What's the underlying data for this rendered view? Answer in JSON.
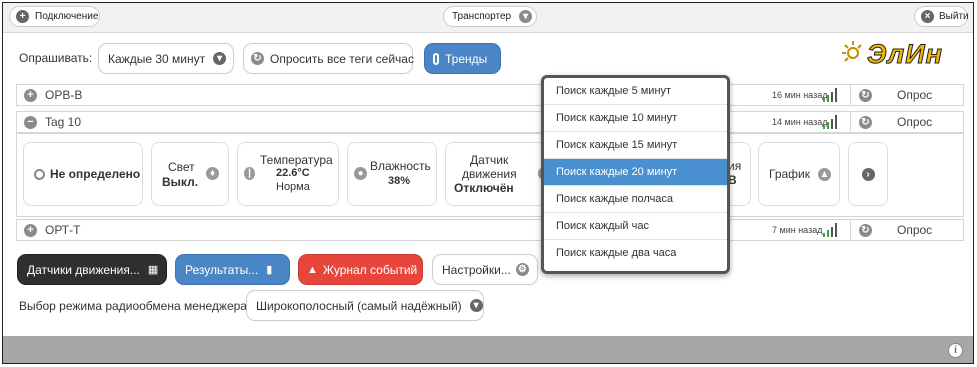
{
  "topbar": {
    "connect": "Подключение",
    "transport": "Транспортер",
    "exit": "Выйти"
  },
  "toolbar": {
    "poll_label": "Опрашивать:",
    "interval_value": "Каждые 30 минут",
    "poll_all": "Опросить все теги сейчас",
    "trends": "Тренды"
  },
  "logo": {
    "text": "ЭлИн",
    "color": "#f2b705"
  },
  "tags": [
    {
      "name": "ОРВ-В",
      "time": "16 мин назад",
      "action": "Опрос"
    },
    {
      "name": "Tag 10",
      "time": "14 мин назад",
      "action": "Опрос"
    },
    {
      "name": "ОРТ-Т",
      "time": "7 мин назад",
      "action": "Опрос"
    }
  ],
  "cards": {
    "state": "Не определено",
    "light_label": "Свет",
    "light_value": "Выкл.",
    "temp_label": "Температура",
    "temp_value": "22.6°C",
    "temp_status": "Норма",
    "humidity_label": "Влажность",
    "humidity_value": "38%",
    "motion_label1": "Датчик",
    "motion_label2": "движения",
    "motion_value": "Отключён",
    "hidden_partial1": "ия",
    "hidden_partial2": "В",
    "graph": "График"
  },
  "dropdown": {
    "items": [
      "Поиск каждые 5 минут",
      "Поиск каждые 10 минут",
      "Поиск каждые 15 минут",
      "Поиск каждые 20 минут",
      "Поиск каждые полчаса",
      "Поиск каждый час",
      "Поиск каждые два часа"
    ],
    "selected_index": 3
  },
  "actions": {
    "motion_sensors": "Датчики движения...",
    "results": "Результаты...",
    "events": "Журнал событий",
    "settings": "Настройки..."
  },
  "radio": {
    "label": "Выбор режима радиообмена менеджера:",
    "value": "Широкополосный (самый надёжный)"
  },
  "colors": {
    "accent_blue": "#4a86c5",
    "dropdown_active": "#4a90d0",
    "danger": "#e8463d",
    "dark": "#2f2f2f",
    "signal_green": "#3aa63a"
  }
}
